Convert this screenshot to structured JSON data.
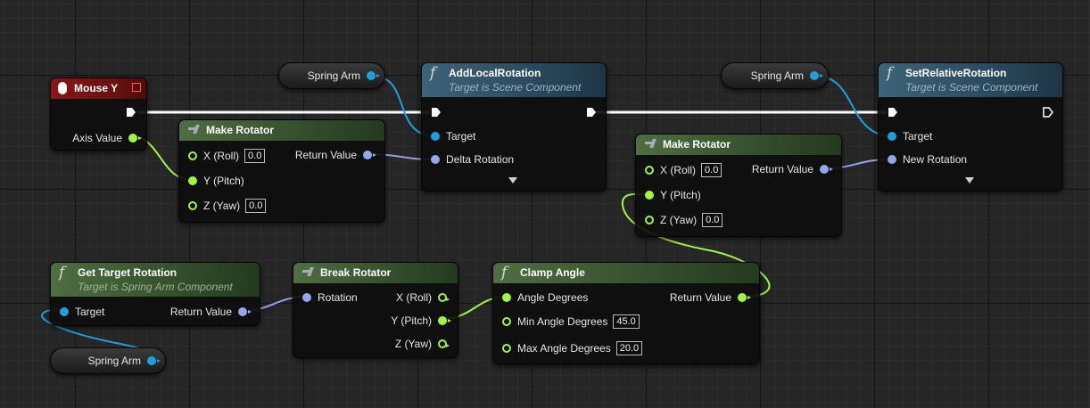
{
  "colors": {
    "object_pin": "#1fa0dc",
    "float_pin": "#a3f341",
    "rotator_pin": "#9aa4ee",
    "exec_wire": "#ffffff",
    "function_header": "#3d6379",
    "pure_header": "#4f6e43",
    "event_header": "#8a1616"
  },
  "nodes": {
    "mouse_y": {
      "title": "Mouse Y",
      "axis_value": "Axis Value"
    },
    "make_rotator_1": {
      "title": "Make Rotator",
      "x_label": "X (Roll)",
      "x_value": "0.0",
      "y_label": "Y (Pitch)",
      "z_label": "Z (Yaw)",
      "z_value": "0.0",
      "return_label": "Return Value"
    },
    "spring_arm_1": {
      "label": "Spring Arm"
    },
    "add_local_rotation": {
      "title": "AddLocalRotation",
      "subtitle": "Target is Scene Component",
      "target_label": "Target",
      "delta_label": "Delta Rotation"
    },
    "spring_arm_2": {
      "label": "Spring Arm"
    },
    "set_relative_rotation": {
      "title": "SetRelativeRotation",
      "subtitle": "Target is Scene Component",
      "target_label": "Target",
      "new_rotation_label": "New Rotation"
    },
    "make_rotator_2": {
      "title": "Make Rotator",
      "x_label": "X (Roll)",
      "x_value": "0.0",
      "y_label": "Y (Pitch)",
      "z_label": "Z (Yaw)",
      "z_value": "0.0",
      "return_label": "Return Value"
    },
    "get_target_rotation": {
      "title": "Get Target Rotation",
      "subtitle": "Target is Spring Arm Component",
      "target_label": "Target",
      "return_label": "Return Value"
    },
    "spring_arm_3": {
      "label": "Spring Arm"
    },
    "break_rotator": {
      "title": "Break Rotator",
      "rotation_label": "Rotation",
      "x_label": "X (Roll)",
      "y_label": "Y (Pitch)",
      "z_label": "Z (Yaw)"
    },
    "clamp_angle": {
      "title": "Clamp Angle",
      "angle_label": "Angle Degrees",
      "min_label": "Min Angle Degrees",
      "min_value": "45.0",
      "max_label": "Max Angle Degrees",
      "max_value": "20.0",
      "return_label": "Return Value"
    }
  }
}
